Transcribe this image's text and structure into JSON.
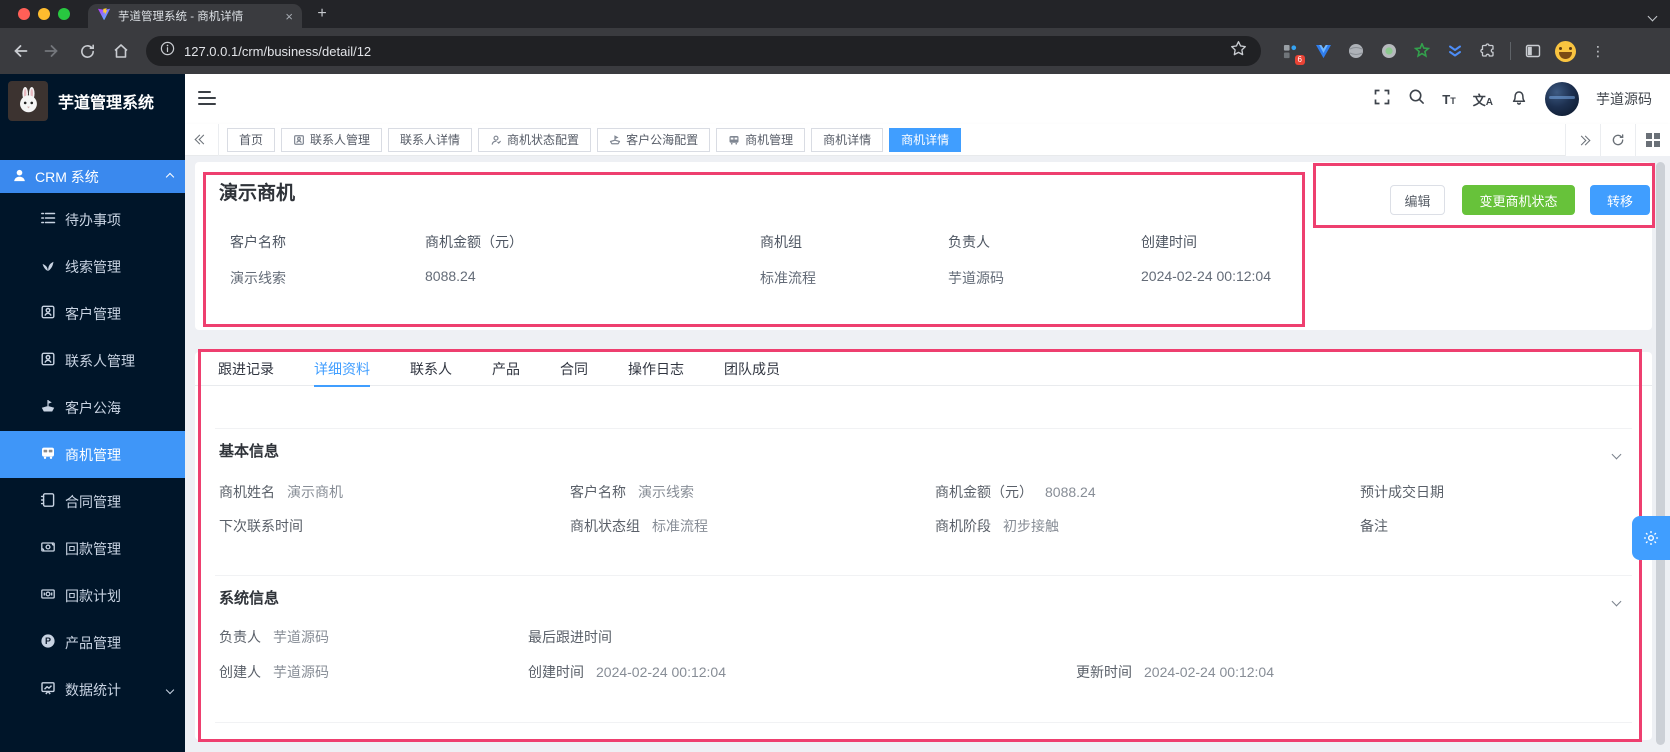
{
  "colors": {
    "accent": "#409eff",
    "success": "#67c23a",
    "annotation": "#ee3f6f",
    "sidebar_bg": "#001529"
  },
  "browser": {
    "tab_title": "芋道管理系统 - 商机详情",
    "url": "127.0.0.1/crm/business/detail/12",
    "extension_badge": "6"
  },
  "sidebar": {
    "logo_title": "芋道管理系统",
    "root_item": {
      "label": "CRM 系统"
    },
    "items": [
      {
        "label": "待办事项"
      },
      {
        "label": "线索管理"
      },
      {
        "label": "客户管理"
      },
      {
        "label": "联系人管理"
      },
      {
        "label": "客户公海"
      },
      {
        "label": "商机管理"
      },
      {
        "label": "合同管理"
      },
      {
        "label": "回款管理"
      },
      {
        "label": "回款计划"
      },
      {
        "label": "产品管理"
      },
      {
        "label": "数据统计"
      }
    ]
  },
  "topbar": {
    "username": "芋道源码"
  },
  "tag_tabs": [
    {
      "label": "首页"
    },
    {
      "label": "联系人管理"
    },
    {
      "label": "联系人详情"
    },
    {
      "label": "商机状态配置"
    },
    {
      "label": "客户公海配置"
    },
    {
      "label": "商机管理"
    },
    {
      "label": "商机详情"
    },
    {
      "label": "商机详情"
    }
  ],
  "page": {
    "title": "演示商机",
    "actions": {
      "edit": "编辑",
      "change_status": "变更商机状态",
      "transfer": "转移"
    },
    "summary": [
      {
        "label": "客户名称",
        "value": "演示线索"
      },
      {
        "label": "商机金额（元）",
        "value": "8088.24"
      },
      {
        "label": "商机组",
        "value": "标准流程"
      },
      {
        "label": "负责人",
        "value": "芋道源码"
      },
      {
        "label": "创建时间",
        "value": "2024-02-24 00:12:04"
      }
    ],
    "detail_tabs": [
      {
        "label": "跟进记录"
      },
      {
        "label": "详细资料"
      },
      {
        "label": "联系人"
      },
      {
        "label": "产品"
      },
      {
        "label": "合同"
      },
      {
        "label": "操作日志"
      },
      {
        "label": "团队成员"
      }
    ],
    "basic_info": {
      "title": "基本信息",
      "fields": {
        "name": {
          "label": "商机姓名",
          "value": "演示商机"
        },
        "customer": {
          "label": "客户名称",
          "value": "演示线索"
        },
        "amount": {
          "label": "商机金额（元）",
          "value": "8088.24"
        },
        "deal_date": {
          "label": "预计成交日期",
          "value": ""
        },
        "next_contact": {
          "label": "下次联系时间",
          "value": ""
        },
        "status_group": {
          "label": "商机状态组",
          "value": "标准流程"
        },
        "stage": {
          "label": "商机阶段",
          "value": "初步接触"
        },
        "remark": {
          "label": "备注",
          "value": ""
        }
      }
    },
    "system_info": {
      "title": "系统信息",
      "fields": {
        "owner": {
          "label": "负责人",
          "value": "芋道源码"
        },
        "last_follow": {
          "label": "最后跟进时间",
          "value": ""
        },
        "creator": {
          "label": "创建人",
          "value": "芋道源码"
        },
        "create_time": {
          "label": "创建时间",
          "value": "2024-02-24 00:12:04"
        },
        "update_time": {
          "label": "更新时间",
          "value": "2024-02-24 00:12:04"
        }
      }
    }
  }
}
